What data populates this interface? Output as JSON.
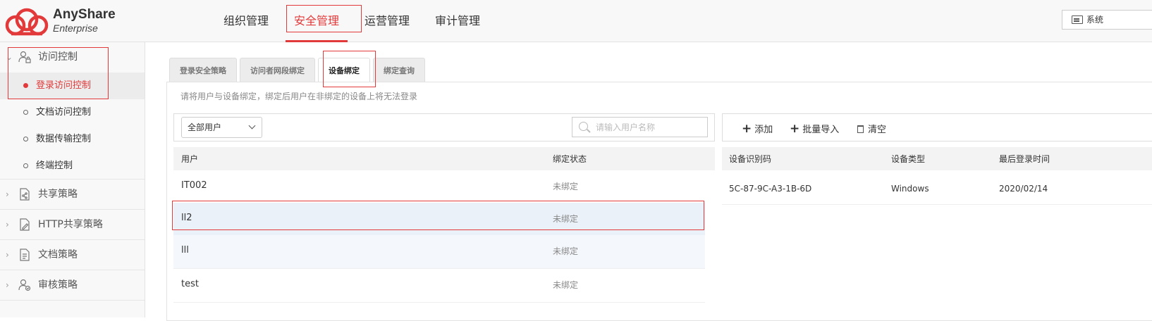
{
  "app": {
    "logo_title": "AnyShare",
    "logo_sub": "Enterprise",
    "brand_color": "#e23a3a"
  },
  "nav": {
    "items": [
      {
        "label": "组织管理"
      },
      {
        "label": "安全管理",
        "active": true
      },
      {
        "label": "运营管理"
      },
      {
        "label": "审计管理"
      }
    ],
    "system_button": "系统"
  },
  "sidebar": {
    "groups": [
      {
        "label": "访问控制",
        "icon": "user-lock-icon",
        "expanded": true
      },
      {
        "label": "共享策略",
        "icon": "share-doc-icon"
      },
      {
        "label": "HTTP共享策略",
        "icon": "edit-doc-icon"
      },
      {
        "label": "文档策略",
        "icon": "doc-icon"
      },
      {
        "label": "审核策略",
        "icon": "user-audit-icon"
      }
    ],
    "access_items": [
      {
        "label": "登录访问控制",
        "active": true
      },
      {
        "label": "文档访问控制"
      },
      {
        "label": "数据传输控制"
      },
      {
        "label": "终端控制"
      }
    ]
  },
  "tabs": [
    {
      "label": "登录安全策略"
    },
    {
      "label": "访问者网段绑定"
    },
    {
      "label": "设备绑定",
      "active": true
    },
    {
      "label": "绑定查询"
    }
  ],
  "hint": "请将用户与设备绑定，绑定后用户在非绑定的设备上将无法登录",
  "user_panel": {
    "filter_selected": "全部用户",
    "search_placeholder": "请输入用户名称",
    "columns": [
      "用户",
      "绑定状态"
    ],
    "rows": [
      {
        "user": "IT002",
        "status": "未绑定"
      },
      {
        "user": "ll2",
        "status": "未绑定",
        "selected": true
      },
      {
        "user": "lll",
        "status": "未绑定"
      },
      {
        "user": "test",
        "status": "未绑定"
      }
    ]
  },
  "device_panel": {
    "add_label": "添加",
    "import_label": "批量导入",
    "clear_label": "清空",
    "columns": [
      "设备识别码",
      "设备类型",
      "最后登录时间"
    ],
    "rows": [
      {
        "code": "5C-87-9C-A3-1B-6D",
        "type": "Windows",
        "last_login": "2020/02/14"
      }
    ]
  }
}
